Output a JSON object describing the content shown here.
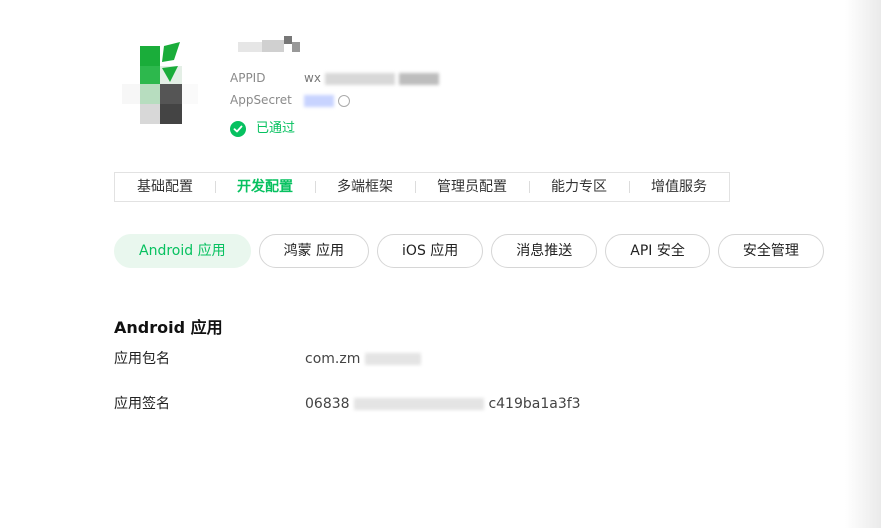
{
  "app": {
    "icon_name": "app-logo-icon",
    "appid_label": "APPID",
    "appid_value_visible": "wx",
    "appsecret_label": "AppSecret",
    "status_text": "已通过",
    "status_color": "#07c160"
  },
  "tabs": [
    {
      "label": "基础配置",
      "active": false
    },
    {
      "label": "开发配置",
      "active": true
    },
    {
      "label": "多端框架",
      "active": false
    },
    {
      "label": "管理员配置",
      "active": false
    },
    {
      "label": "能力专区",
      "active": false
    },
    {
      "label": "增值服务",
      "active": false
    }
  ],
  "pills": [
    {
      "label": "Android 应用",
      "active": true
    },
    {
      "label": "鸿蒙 应用",
      "active": false
    },
    {
      "label": "iOS 应用",
      "active": false
    },
    {
      "label": "消息推送",
      "active": false
    },
    {
      "label": "API 安全",
      "active": false
    },
    {
      "label": "安全管理",
      "active": false
    }
  ],
  "section": {
    "title": "Android 应用",
    "package_label": "应用包名",
    "package_value_visible": "com.zm",
    "signature_label": "应用签名",
    "signature_prefix": "06838",
    "signature_suffix": "c419ba1a3f3"
  },
  "colors": {
    "accent": "#07c160",
    "accent_bg": "#e9f7ee"
  }
}
